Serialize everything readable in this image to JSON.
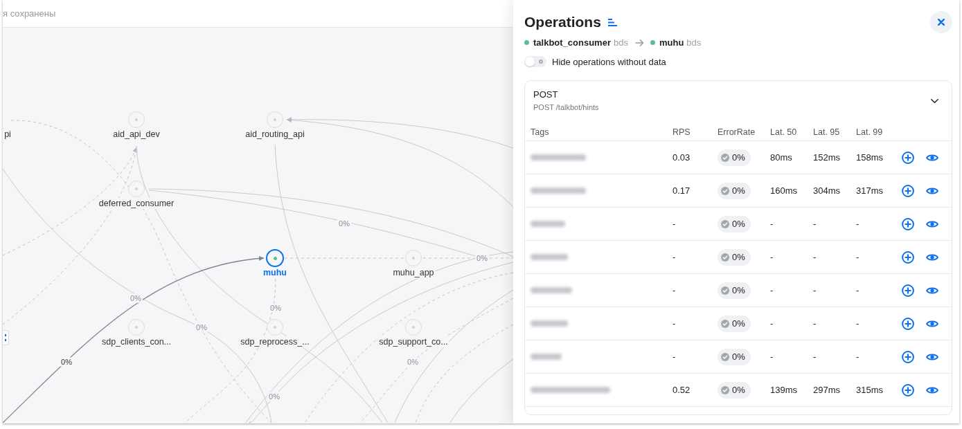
{
  "top_bar": {
    "status_text": "я сохранены"
  },
  "graph": {
    "nodes": [
      {
        "label": "pi",
        "selected": false
      },
      {
        "label": "aid_api_dev",
        "selected": false,
        "color": "#cfd1d5"
      },
      {
        "label": "aid_routing_api",
        "selected": false,
        "color": "#cfd1d5"
      },
      {
        "label": "deferred_consumer",
        "selected": false,
        "color": "#cfd1d5"
      },
      {
        "label": "muhu",
        "selected": true,
        "color": "#5cbf93"
      },
      {
        "label": "muhu_app",
        "selected": false,
        "color": "#cfd1d5"
      },
      {
        "label": "sdp_clients_con...",
        "selected": false,
        "color": "#cfd1d5"
      },
      {
        "label": "sdp_reprocess_...",
        "selected": false,
        "color": "#cfd1d5"
      },
      {
        "label": "sdp_support_co...",
        "selected": false,
        "color": "#cfd1d5"
      }
    ],
    "edge_labels": [
      {
        "text": "0%",
        "highlighted": false
      },
      {
        "text": "0%",
        "highlighted": false
      },
      {
        "text": "0%",
        "highlighted": false
      },
      {
        "text": "0%",
        "highlighted": false
      },
      {
        "text": "0%",
        "highlighted": false
      },
      {
        "text": "0%",
        "highlighted": true
      },
      {
        "text": "0%",
        "highlighted": false
      },
      {
        "text": "0%",
        "highlighted": false
      }
    ]
  },
  "operations_panel": {
    "title": "Operations",
    "route": {
      "source": {
        "name": "talkbot_consumer",
        "namespace": "bds",
        "color": "#5cbf93"
      },
      "target": {
        "name": "muhu",
        "namespace": "bds",
        "color": "#5cbf93"
      }
    },
    "hide_empty_toggle": {
      "label": "Hide operations without data",
      "on": false
    },
    "operation": {
      "method": "POST",
      "path": "POST /talkbot/hints",
      "expanded": true,
      "columns": [
        "Tags",
        "RPS",
        "ErrorRate",
        "Lat. 50",
        "Lat. 95",
        "Lat. 99"
      ],
      "rows": [
        {
          "rps": "0.03",
          "error_rate": "0%",
          "lat_50": "80ms",
          "lat_95": "152ms",
          "lat_99": "158ms"
        },
        {
          "rps": "0.17",
          "error_rate": "0%",
          "lat_50": "160ms",
          "lat_95": "304ms",
          "lat_99": "317ms"
        },
        {
          "rps": "-",
          "error_rate": "0%",
          "lat_50": "-",
          "lat_95": "-",
          "lat_99": "-"
        },
        {
          "rps": "-",
          "error_rate": "0%",
          "lat_50": "-",
          "lat_95": "-",
          "lat_99": "-"
        },
        {
          "rps": "-",
          "error_rate": "0%",
          "lat_50": "-",
          "lat_95": "-",
          "lat_99": "-"
        },
        {
          "rps": "-",
          "error_rate": "0%",
          "lat_50": "-",
          "lat_95": "-",
          "lat_99": "-"
        },
        {
          "rps": "-",
          "error_rate": "0%",
          "lat_50": "-",
          "lat_95": "-",
          "lat_99": "-"
        },
        {
          "rps": "0.52",
          "error_rate": "0%",
          "lat_50": "139ms",
          "lat_95": "297ms",
          "lat_99": "315ms"
        }
      ]
    }
  }
}
